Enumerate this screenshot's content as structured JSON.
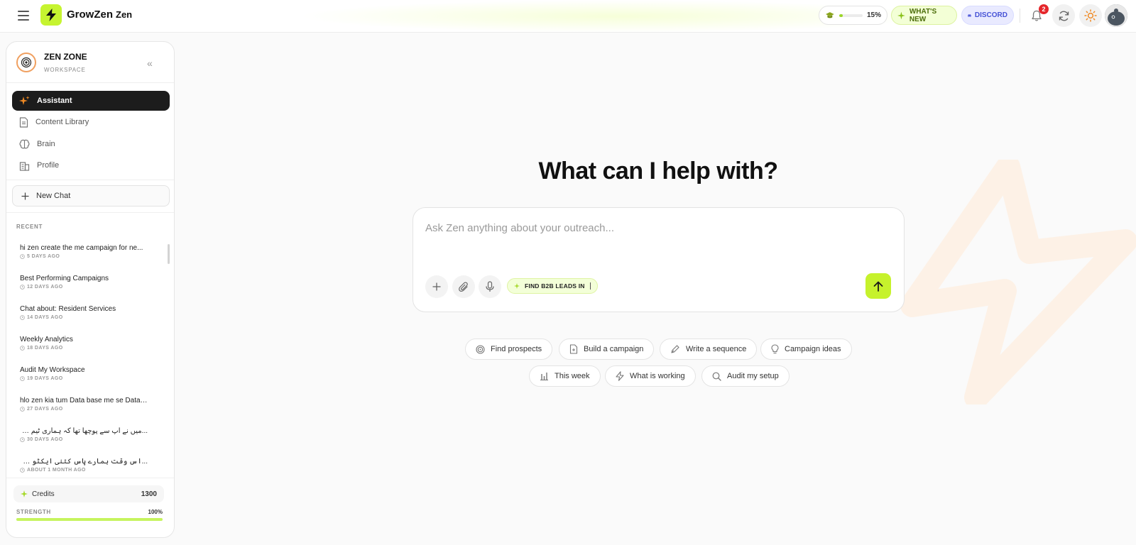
{
  "header": {
    "brand": "GrowZen",
    "product": "Zen",
    "progress_percent": 15,
    "progress_label": "15%",
    "whats_new_label": "WHAT'S NEW",
    "discord_label": "DISCORD",
    "notification_count": "2",
    "accent_color": "#c6f430"
  },
  "sidebar": {
    "workspace_name": "ZEN ZONE",
    "workspace_sub": "WORKSPACE",
    "nav": [
      {
        "label": "Assistant",
        "icon": "sparkle-icon",
        "active": true
      },
      {
        "label": "Content Library",
        "icon": "document-icon",
        "active": false
      },
      {
        "label": "Brain",
        "icon": "brain-icon",
        "active": false
      },
      {
        "label": "Profile",
        "icon": "building-icon",
        "active": false
      }
    ],
    "new_chat_label": "New Chat",
    "recent_label": "RECENT",
    "chats": [
      {
        "title": "hi zen create the me campaign for ne...",
        "age": "5 DAYS AGO"
      },
      {
        "title": "Best Performing Campaigns",
        "age": "12 DAYS AGO"
      },
      {
        "title": "Chat about: Resident Services",
        "age": "14 DAYS AGO"
      },
      {
        "title": "Weekly Analytics",
        "age": "18 DAYS AGO"
      },
      {
        "title": "Audit My Workspace",
        "age": "19 DAYS AGO"
      },
      {
        "title": "hlo zen kia tum Data base me se Data ...",
        "age": "27 DAYS AGO"
      },
      {
        "title": "...میں نے آپ سے پوچھا تھا کہ ہماری ٹیم کی کارکردگی",
        "age": "30 DAYS AGO"
      },
      {
        "title": "...اس وقت ہمارے پاس کتنی ایکٹو کمپینز ہیں",
        "age": "ABOUT 1 MONTH AGO"
      }
    ],
    "credits_label": "Credits",
    "credits_value": "1300",
    "strength_label": "STRENGTH",
    "strength_value": "100%",
    "strength_percent": 100
  },
  "main": {
    "headline": "What can I help with?",
    "input_placeholder": "Ask Zen anything about your outreach...",
    "input_value": "",
    "chip_label": "FIND B2B LEADS IN",
    "suggestions_row1": [
      {
        "label": "Find prospects",
        "icon": "target-icon"
      },
      {
        "label": "Build a campaign",
        "icon": "document-plus-icon"
      },
      {
        "label": "Write a sequence",
        "icon": "pen-icon"
      },
      {
        "label": "Campaign ideas",
        "icon": "lightbulb-icon"
      }
    ],
    "suggestions_row2": [
      {
        "label": "This week",
        "icon": "bar-chart-icon"
      },
      {
        "label": "What is working",
        "icon": "bolt-icon"
      },
      {
        "label": "Audit my setup",
        "icon": "search-icon"
      }
    ]
  }
}
